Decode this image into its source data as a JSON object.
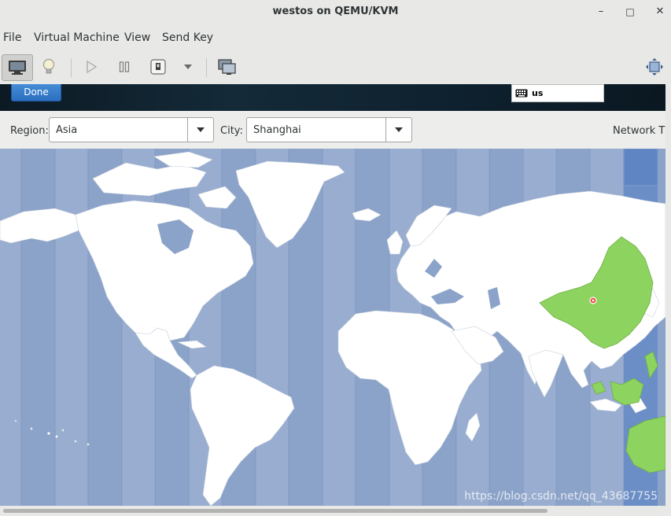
{
  "window": {
    "title": "westos on QEMU/KVM",
    "minimize_glyph": "–",
    "maximize_glyph": "□",
    "close_glyph": "✕"
  },
  "menu": {
    "file": "File",
    "virtual_machine": "Virtual Machine",
    "view": "View",
    "send_key": "Send Key"
  },
  "toolbar": {
    "icons": [
      "console-icon",
      "details-lightbulb-icon",
      "run-icon",
      "pause-icon",
      "shutdown-icon",
      "shutdown-menu-icon",
      "snapshots-icon",
      "fullscreen-icon"
    ]
  },
  "installer": {
    "done_label": "Done",
    "keyboard_layout": "us"
  },
  "timezone": {
    "region_label": "Region:",
    "region_value": "Asia",
    "city_label": "City:",
    "city_value": "Shanghai",
    "network_time_label": "Network T"
  },
  "map": {
    "ocean_color": "#8ca3c9",
    "land_color": "#ffffff",
    "selected_zone_color": "#8dd35f",
    "selected_city": "Shanghai",
    "watermark": "https://blog.csdn.net/qq_43687755"
  }
}
